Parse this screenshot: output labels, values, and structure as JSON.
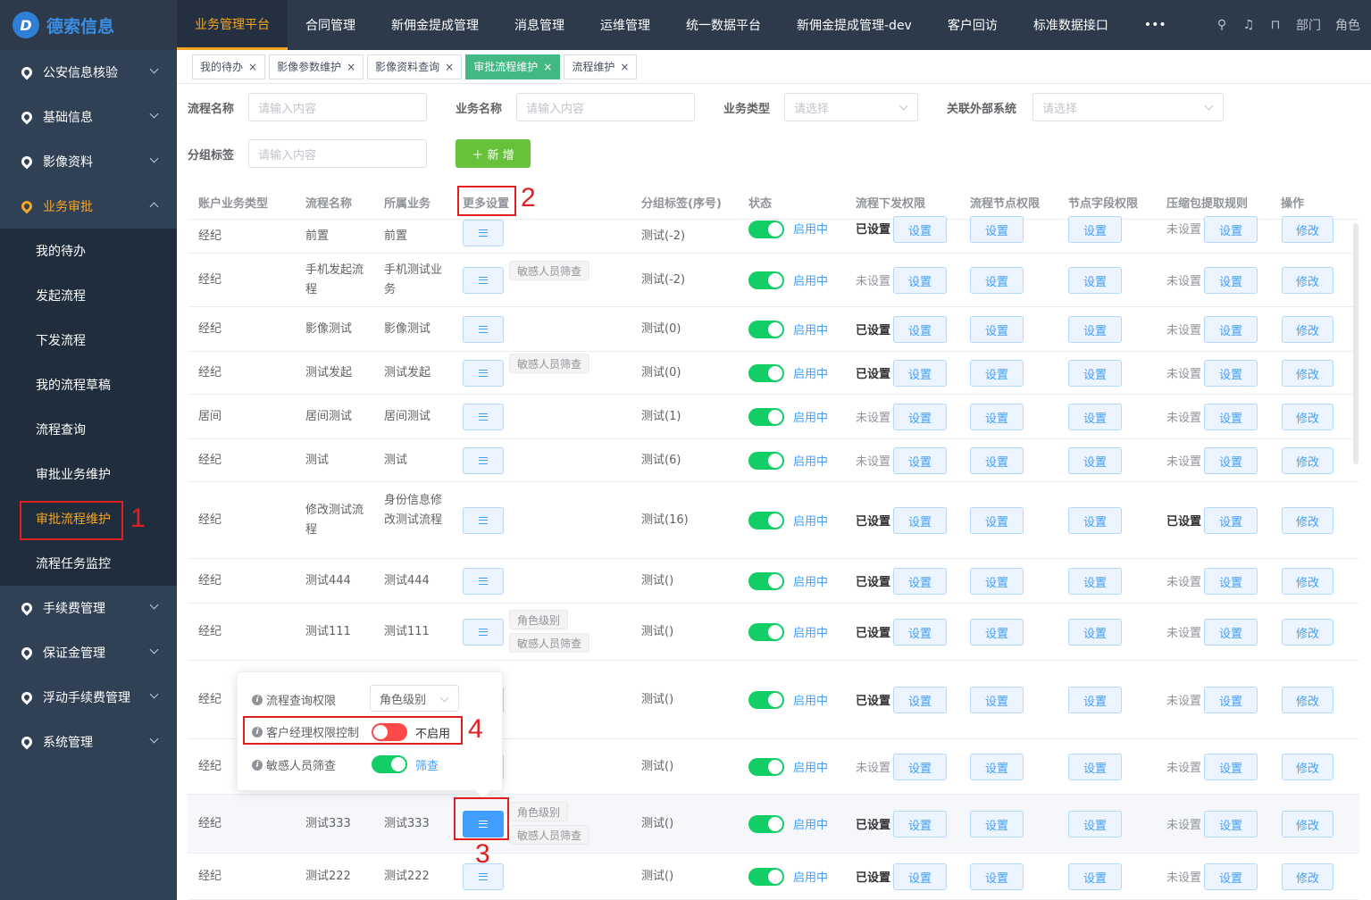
{
  "app": {
    "logo": "德索信息"
  },
  "topnav": [
    {
      "label": "业务管理平台",
      "active": true
    },
    {
      "label": "合同管理"
    },
    {
      "label": "新佣金提成管理"
    },
    {
      "label": "消息管理"
    },
    {
      "label": "运维管理"
    },
    {
      "label": "统一数据平台"
    },
    {
      "label": "新佣金提成管理-dev"
    },
    {
      "label": "客户回访"
    },
    {
      "label": "标准数据接口"
    },
    {
      "label": "•••"
    }
  ],
  "topright": {
    "dept": "部门",
    "role": "角色"
  },
  "sidebar": {
    "groups_top": [
      "公安信息核验",
      "基础信息",
      "影像资料"
    ],
    "open_group": "业务审批",
    "sub_items": [
      "我的待办",
      "发起流程",
      "下发流程",
      "我的流程草稿",
      "流程查询",
      "审批业务维护",
      "审批流程维护",
      "流程任务监控"
    ],
    "groups_bottom": [
      "手续费管理",
      "保证金管理",
      "浮动手续费管理",
      "系统管理"
    ]
  },
  "tabs": [
    {
      "label": "我的待办"
    },
    {
      "label": "影像参数维护"
    },
    {
      "label": "影像资料查询"
    },
    {
      "label": "审批流程维护",
      "active": true
    },
    {
      "label": "流程维护"
    }
  ],
  "filters": {
    "flow_name_label": "流程名称",
    "flow_name_placeholder": "请输入内容",
    "biz_name_label": "业务名称",
    "biz_name_placeholder": "请输入内容",
    "biz_type_label": "业务类型",
    "biz_type_placeholder": "请选择",
    "ext_sys_label": "关联外部系统",
    "ext_sys_placeholder": "请选择",
    "group_tag_label": "分组标签",
    "group_tag_placeholder": "请输入内容",
    "add_label": "＋ 新 增"
  },
  "table": {
    "headers": [
      "账户业务类型",
      "流程名称",
      "所属业务",
      "更多设置",
      "分组标签(序号)",
      "状态",
      "流程下发权限",
      "流程节点权限",
      "节点字段权限",
      "压缩包提取规则",
      "操作"
    ],
    "status_on": "启用中",
    "set_label": "设置",
    "edit_label": "修改",
    "perm_set": "已设置",
    "perm_unset": "未设置",
    "rows": [
      {
        "type": "经纪",
        "name": "前置",
        "biz": "前置",
        "tags": [],
        "group": "测试(-2)",
        "dispatch": "已设置",
        "zip": "未设置"
      },
      {
        "type": "经纪",
        "name": "手机发起流程",
        "biz": "手机测试业务",
        "tags": [
          "敏感人员筛查"
        ],
        "group": "测试(-2)",
        "dispatch": "未设置",
        "zip": "未设置"
      },
      {
        "type": "经纪",
        "name": "影像测试",
        "biz": "影像测试",
        "tags": [],
        "group": "测试(0)",
        "dispatch": "已设置",
        "zip": "未设置"
      },
      {
        "type": "经纪",
        "name": "测试发起",
        "biz": "测试发起",
        "tags": [
          "敏感人员筛查"
        ],
        "group": "测试(0)",
        "dispatch": "已设置",
        "zip": "未设置"
      },
      {
        "type": "居间",
        "name": "居间测试",
        "biz": "居间测试",
        "tags": [],
        "group": "测试(1)",
        "dispatch": "未设置",
        "zip": "未设置"
      },
      {
        "type": "经纪",
        "name": "测试",
        "biz": "测试",
        "tags": [],
        "group": "测试(6)",
        "dispatch": "未设置",
        "zip": "未设置"
      },
      {
        "type": "经纪",
        "name": "修改测试流程",
        "biz": "身份信息修改测试流程",
        "tags": [],
        "group": "测试(16)",
        "dispatch": "已设置",
        "zip": "已设置"
      },
      {
        "type": "经纪",
        "name": "测试444",
        "biz": "测试444",
        "tags": [],
        "group": "测试()",
        "dispatch": "已设置",
        "zip": "未设置"
      },
      {
        "type": "经纪",
        "name": "测试111",
        "biz": "测试111",
        "tags": [
          "角色级别",
          "敏感人员筛查"
        ],
        "group": "测试()",
        "dispatch": "已设置",
        "zip": "未设置"
      },
      {
        "type": "经纪",
        "name": "",
        "biz": "",
        "tags": [],
        "group": "测试()",
        "dispatch": "已设置",
        "zip": "未设置"
      },
      {
        "type": "经纪",
        "name": "",
        "biz": "",
        "tags": [],
        "group": "测试()",
        "dispatch": "未设置",
        "zip": "未设置"
      },
      {
        "type": "经纪",
        "name": "测试333",
        "biz": "测试333",
        "tags": [
          "角色级别",
          "敏感人员筛查"
        ],
        "group": "测试()",
        "dispatch": "已设置",
        "zip": "未设置"
      },
      {
        "type": "经纪",
        "name": "测试222",
        "biz": "测试222",
        "tags": [],
        "group": "测试()",
        "dispatch": "已设置",
        "zip": "未设置"
      }
    ]
  },
  "popover": {
    "query_perm_label": "流程查询权限",
    "query_perm_value": "角色级别",
    "mgr_ctrl_label": "客户经理权限控制",
    "mgr_ctrl_value": "不启用",
    "sensitive_label": "敏感人员筛查",
    "sensitive_value": "筛查"
  },
  "annotations": [
    "1",
    "2",
    "3",
    "4"
  ],
  "colors": {
    "accent": "#f5a623",
    "primary": "#409eff",
    "success": "#13ce66",
    "danger": "#ff4949",
    "annotation": "#e02020"
  }
}
